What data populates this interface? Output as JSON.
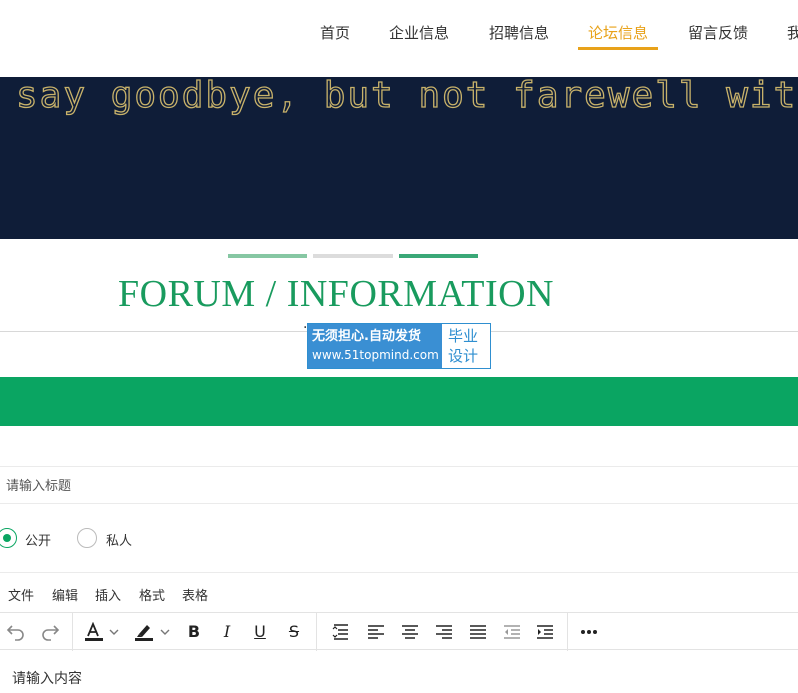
{
  "nav": {
    "items": [
      "首页",
      "企业信息",
      "招聘信息",
      "论坛信息",
      "留言反馈",
      "我"
    ],
    "active_index": 3,
    "active_color": "#e8a21a"
  },
  "banner": {
    "text": "say goodbye, but not farewell with y",
    "background": "#0f1d38",
    "text_color": "#c8b26a"
  },
  "section": {
    "heading": "FORUM / INFORMATION",
    "heading_color": "#199b5e",
    "subtitle_fragment": "· · ·"
  },
  "watermark": {
    "line1": "无须担心.自动发货",
    "line2": "www.51topmind.com",
    "right": "毕业设计"
  },
  "form": {
    "title_placeholder": "请输入标题",
    "visibility_options": [
      {
        "label": "公开",
        "checked": true
      },
      {
        "label": "私人",
        "checked": false
      }
    ],
    "editor_menu": [
      "文件",
      "编辑",
      "插入",
      "格式",
      "表格"
    ],
    "editor_placeholder": "请输入内容"
  },
  "colors": {
    "accent_green": "#0aa562"
  },
  "icons": {
    "toolbar": [
      "undo-icon",
      "redo-icon",
      "text-color-icon",
      "highlight-icon",
      "bold-icon",
      "italic-icon",
      "underline-icon",
      "strikethrough-icon",
      "line-height-icon",
      "align-left-icon",
      "align-center-icon",
      "align-right-icon",
      "justify-icon",
      "outdent-icon",
      "indent-icon",
      "more-icon"
    ]
  }
}
